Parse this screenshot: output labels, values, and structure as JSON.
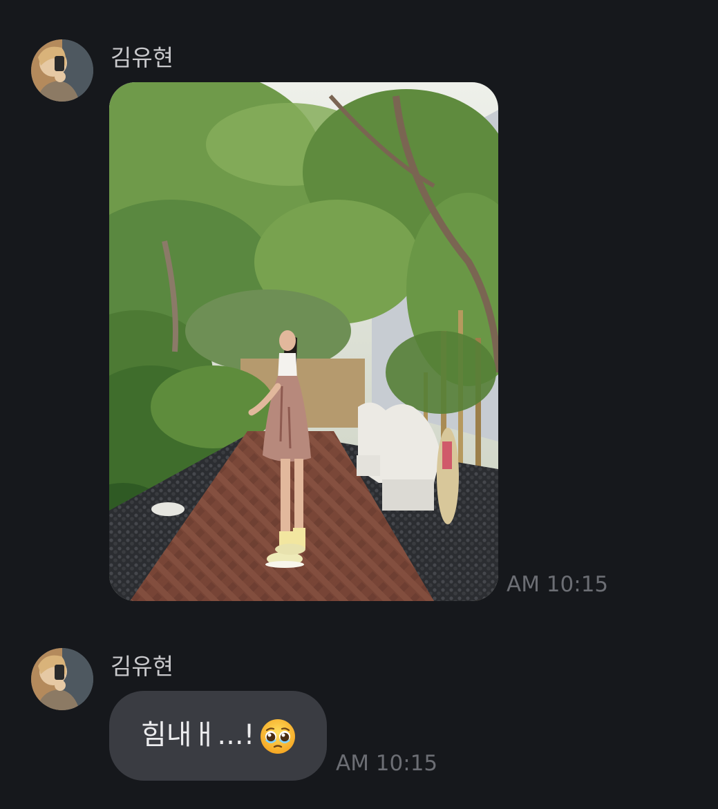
{
  "messages": [
    {
      "sender": "김유현",
      "type": "image",
      "image_alt": "Woman in a floral dress and yellow sneakers standing on a herringbone brick garden path under green trees",
      "time": "AM 10:15"
    },
    {
      "sender": "김유현",
      "type": "text",
      "text": "힘내ㅐ...!",
      "emoji": "pleading-face",
      "time": "AM 10:15"
    }
  ],
  "colors": {
    "background": "#16181c",
    "bubble": "#3a3c42",
    "sender_text": "#c9c9cc",
    "time_text": "#6c6e74",
    "message_text": "#ececee"
  }
}
